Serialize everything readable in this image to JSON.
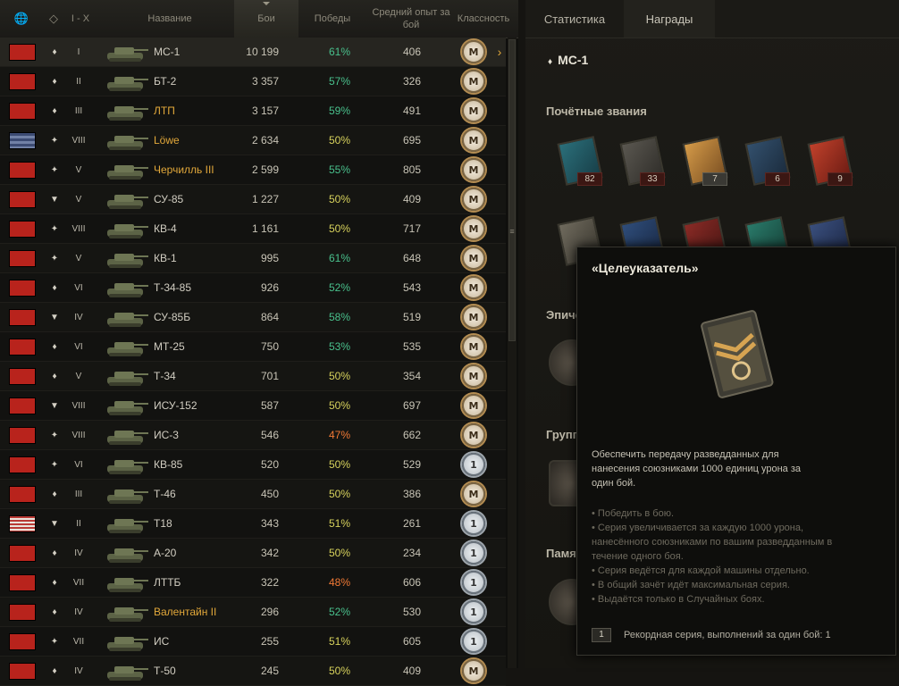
{
  "columns": {
    "tier": "I - X",
    "name": "Название",
    "battles": "Бои",
    "wins": "Победы",
    "avg_xp": "Средний опыт за бой",
    "mastery": "Классность"
  },
  "rows": [
    {
      "flag": "ussr",
      "type_icon": "light-tank-icon",
      "tier": "I",
      "name": "МС-1",
      "premium": false,
      "battles": "10 199",
      "wins": "61%",
      "win_color": "green",
      "xp": "406",
      "mastery": "M",
      "selected": true
    },
    {
      "flag": "ussr",
      "type_icon": "light-tank-icon",
      "tier": "II",
      "name": "БТ-2",
      "premium": false,
      "battles": "3 357",
      "wins": "57%",
      "win_color": "green",
      "xp": "326",
      "mastery": "M"
    },
    {
      "flag": "ussr",
      "type_icon": "light-tank-icon",
      "tier": "III",
      "name": "ЛТП",
      "premium": true,
      "battles": "3 157",
      "wins": "59%",
      "win_color": "green",
      "xp": "491",
      "mastery": "M"
    },
    {
      "flag": "germany",
      "type_icon": "heavy-tank-icon",
      "tier": "VIII",
      "name": "Löwe",
      "premium": true,
      "battles": "2 634",
      "wins": "50%",
      "win_color": "yellow",
      "xp": "695",
      "mastery": "M"
    },
    {
      "flag": "ussr",
      "type_icon": "heavy-tank-icon",
      "tier": "V",
      "name": "Черчилль III",
      "premium": true,
      "battles": "2 599",
      "wins": "55%",
      "win_color": "green",
      "xp": "805",
      "mastery": "M"
    },
    {
      "flag": "ussr",
      "type_icon": "td-icon",
      "tier": "V",
      "name": "СУ-85",
      "premium": false,
      "battles": "1 227",
      "wins": "50%",
      "win_color": "yellow",
      "xp": "409",
      "mastery": "M"
    },
    {
      "flag": "ussr",
      "type_icon": "heavy-tank-icon",
      "tier": "VIII",
      "name": "КВ-4",
      "premium": false,
      "battles": "1 161",
      "wins": "50%",
      "win_color": "yellow",
      "xp": "717",
      "mastery": "M"
    },
    {
      "flag": "ussr",
      "type_icon": "heavy-tank-icon",
      "tier": "V",
      "name": "КВ-1",
      "premium": false,
      "battles": "995",
      "wins": "61%",
      "win_color": "green",
      "xp": "648",
      "mastery": "M"
    },
    {
      "flag": "ussr",
      "type_icon": "medium-tank-icon",
      "tier": "VI",
      "name": "Т-34-85",
      "premium": false,
      "battles": "926",
      "wins": "52%",
      "win_color": "green",
      "xp": "543",
      "mastery": "M"
    },
    {
      "flag": "ussr",
      "type_icon": "td-icon",
      "tier": "IV",
      "name": "СУ-85Б",
      "premium": false,
      "battles": "864",
      "wins": "58%",
      "win_color": "green",
      "xp": "519",
      "mastery": "M"
    },
    {
      "flag": "ussr",
      "type_icon": "medium-tank-icon",
      "tier": "VI",
      "name": "МТ-25",
      "premium": false,
      "battles": "750",
      "wins": "53%",
      "win_color": "green",
      "xp": "535",
      "mastery": "M"
    },
    {
      "flag": "ussr",
      "type_icon": "medium-tank-icon",
      "tier": "V",
      "name": "Т-34",
      "premium": false,
      "battles": "701",
      "wins": "50%",
      "win_color": "yellow",
      "xp": "354",
      "mastery": "M"
    },
    {
      "flag": "ussr",
      "type_icon": "td-icon",
      "tier": "VIII",
      "name": "ИСУ-152",
      "premium": false,
      "battles": "587",
      "wins": "50%",
      "win_color": "yellow",
      "xp": "697",
      "mastery": "M"
    },
    {
      "flag": "ussr",
      "type_icon": "heavy-tank-icon",
      "tier": "VIII",
      "name": "ИС-3",
      "premium": false,
      "battles": "546",
      "wins": "47%",
      "win_color": "orange",
      "xp": "662",
      "mastery": "M"
    },
    {
      "flag": "ussr",
      "type_icon": "heavy-tank-icon",
      "tier": "VI",
      "name": "КВ-85",
      "premium": false,
      "battles": "520",
      "wins": "50%",
      "win_color": "yellow",
      "xp": "529",
      "mastery": "1"
    },
    {
      "flag": "ussr",
      "type_icon": "medium-tank-icon",
      "tier": "III",
      "name": "Т-46",
      "premium": false,
      "battles": "450",
      "wins": "50%",
      "win_color": "yellow",
      "xp": "386",
      "mastery": "M"
    },
    {
      "flag": "usa",
      "type_icon": "td-icon",
      "tier": "II",
      "name": "T18",
      "premium": false,
      "battles": "343",
      "wins": "51%",
      "win_color": "yellow",
      "xp": "261",
      "mastery": "1"
    },
    {
      "flag": "ussr",
      "type_icon": "medium-tank-icon",
      "tier": "IV",
      "name": "А-20",
      "premium": false,
      "battles": "342",
      "wins": "50%",
      "win_color": "yellow",
      "xp": "234",
      "mastery": "1"
    },
    {
      "flag": "ussr",
      "type_icon": "light-tank-icon",
      "tier": "VII",
      "name": "ЛТТБ",
      "premium": false,
      "battles": "322",
      "wins": "48%",
      "win_color": "orange",
      "xp": "606",
      "mastery": "1"
    },
    {
      "flag": "ussr",
      "type_icon": "medium-tank-icon",
      "tier": "IV",
      "name": "Валентайн II",
      "premium": true,
      "battles": "296",
      "wins": "52%",
      "win_color": "green",
      "xp": "530",
      "mastery": "1"
    },
    {
      "flag": "ussr",
      "type_icon": "heavy-tank-icon",
      "tier": "VII",
      "name": "ИС",
      "premium": false,
      "battles": "255",
      "wins": "51%",
      "win_color": "yellow",
      "xp": "605",
      "mastery": "1"
    },
    {
      "flag": "ussr",
      "type_icon": "medium-tank-icon",
      "tier": "IV",
      "name": "Т-50",
      "premium": false,
      "battles": "245",
      "wins": "50%",
      "win_color": "yellow",
      "xp": "409",
      "mastery": "M"
    }
  ],
  "right": {
    "tabs": [
      "Статистика",
      "Награды"
    ],
    "active_tab": "Награды",
    "vehicle": "МС-1",
    "sections": {
      "honors": "Почётные звания",
      "epic": "Эпические медали",
      "group": "Групповые награды",
      "memorial": "Памятные"
    },
    "honor_counts": [
      "82",
      "33",
      "7",
      "6",
      "9"
    ]
  },
  "tooltip": {
    "title": "«Целеуказатель»",
    "description": "Обеспечить передачу разведданных для нанесения союзниками 1000 единиц урона за один бой.",
    "rules": [
      "Победить в бою.",
      "Серия увеличивается за каждую 1000 урона, нанесённого союзниками по вашим разведданным в течение одного боя.",
      "Серия ведётся для каждой машины отдельно.",
      "В общий зачёт идёт максимальная серия.",
      "Выдаётся только в Случайных боях."
    ],
    "record_value": "1",
    "record_label": "Рекордная серия, выполнений за один бой: 1"
  },
  "colors": {
    "win_green": "#49c08c",
    "win_yellow": "#d7d25c",
    "win_orange": "#f07935",
    "premium_name": "#e2a83a"
  }
}
